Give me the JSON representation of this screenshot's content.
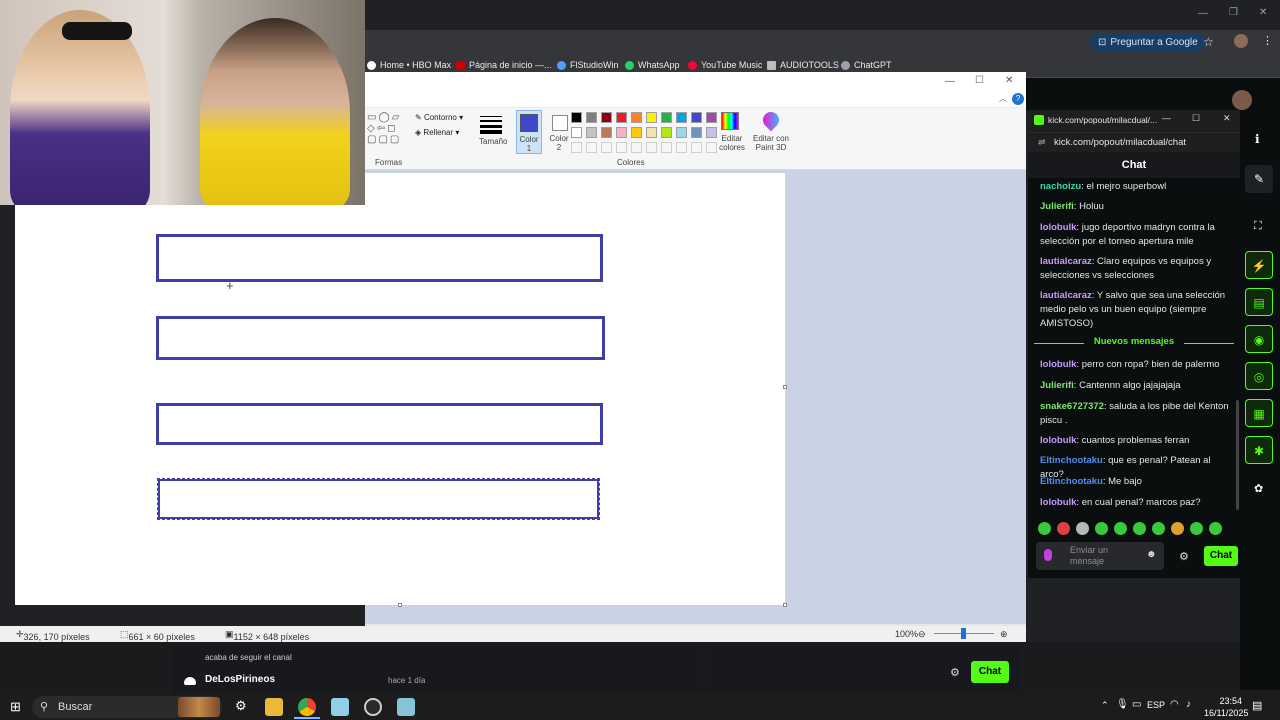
{
  "browser": {
    "google_button": "Preguntar a Google",
    "bookmarks": [
      {
        "label": "Home • HBO Max"
      },
      {
        "label": "Página de inicio —..."
      },
      {
        "label": "FlStudioWin"
      },
      {
        "label": "WhatsApp"
      },
      {
        "label": "YouTube Music"
      },
      {
        "label": "AUDIOTOOLS"
      },
      {
        "label": "ChatGPT"
      }
    ]
  },
  "paint": {
    "ribbon": {
      "contorno": "Contorno",
      "rellenar": "Rellenar",
      "formas": "Formas",
      "tamano": "Tamaño",
      "color1": "Color 1",
      "color2": "Color 2",
      "colores": "Colores",
      "editar_colores": "Editar colores",
      "editar_paint3d": "Editar con Paint 3D"
    },
    "palette": [
      "#000000",
      "#7f7f7f",
      "#880015",
      "#ed1c24",
      "#ff7f27",
      "#fff200",
      "#22b14c",
      "#00a2e8",
      "#3f48cc",
      "#a349a4",
      "#ffffff",
      "#c3c3c3",
      "#b97a57",
      "#ffaec9",
      "#ffc90e",
      "#efe4b0",
      "#b5e61d",
      "#99d9ea",
      "#7092be",
      "#c8bfe7"
    ],
    "color1": "#3f48cc",
    "status": {
      "cursor": "326, 170 píxeles",
      "selection": "661 × 60 píxeles",
      "size": "1152 × 648 píxeles",
      "zoom": "100%"
    }
  },
  "kick": {
    "title": "kick.com/popout/milacdual/...",
    "url": "kick.com/popout/milacdual/chat",
    "header": "Chat",
    "messages": [
      {
        "user": "nachoizu",
        "color": "#36d8b0",
        "text": "el mejro superbowl"
      },
      {
        "user": "Julierifi",
        "color": "#7ce66f",
        "text": "Holuu"
      },
      {
        "user": "lolobulk",
        "color": "#c59bff",
        "text": "jugo deportivo madryn contra la selección por el torneo apertura mile"
      },
      {
        "user": "lautialcaraz",
        "color": "#c59bff",
        "text": "Claro equipos vs equipos y selecciones vs selecciones"
      },
      {
        "user": "lautialcaraz",
        "color": "#c59bff",
        "text": "Y salvo que sea una selección medio pelo vs un buen equipo (siempre AMISTOSO)"
      }
    ],
    "new_messages_label": "Nuevos mensajes",
    "new_messages": [
      {
        "user": "lolobulk",
        "color": "#c59bff",
        "text": "perro con ropa? bien de palermo"
      },
      {
        "user": "Julierifi",
        "color": "#7ce66f",
        "text": "Cantennn algo jajajajaja"
      },
      {
        "user": "snake6727372",
        "color": "#7ce66f",
        "text": "saluda a los pibe del Kenton piscu ."
      },
      {
        "user": "lolobulk",
        "color": "#c59bff",
        "text": "cuantos problemas ferran"
      },
      {
        "user": "Eltinchootaku",
        "color": "#4f8df5",
        "text": "que es penal? Patean al arco?"
      },
      {
        "user": "Eltinchootaku",
        "color": "#4f8df5",
        "text": "Me bajo"
      },
      {
        "user": "lolobulk",
        "color": "#c59bff",
        "text": "en cual penal? marcos paz?"
      }
    ],
    "input_placeholder": "Enviar un mensaje",
    "chat_button": "Chat",
    "accent": "#53fc18"
  },
  "obs": {
    "follow_text": "acaba de seguir el canal",
    "follower": "DeLosPirineos",
    "follower_time": "hace 1 día",
    "chat_button": "Chat"
  },
  "taskbar": {
    "search": "Buscar",
    "lang": "ESP",
    "time": "23:54",
    "date": "16/11/2025"
  }
}
